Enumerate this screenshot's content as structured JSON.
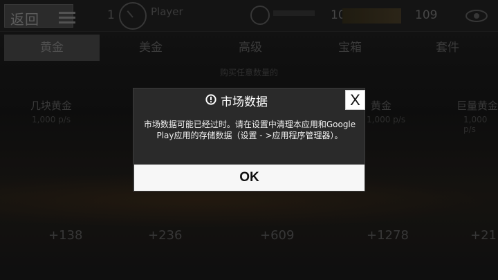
{
  "header": {
    "back_label": "返回",
    "level": "1",
    "player_name": "Player",
    "stat_1": "10",
    "stat_2": "109"
  },
  "tabs": [
    {
      "label": "黄金",
      "active": true
    },
    {
      "label": "美金",
      "active": false
    },
    {
      "label": "高级",
      "active": false
    },
    {
      "label": "宝箱",
      "active": false
    },
    {
      "label": "套件",
      "active": false
    }
  ],
  "store": {
    "note_line_1": "购买任意数量的",
    "items": [
      {
        "name": "几块黄金",
        "price": "1,000 p/s"
      },
      {
        "name": "黄金",
        "price": "1,000 p/s"
      },
      {
        "name": "巨量黄金",
        "price": "1,000 p/s"
      }
    ],
    "bonuses": [
      "+138",
      "+236",
      "+609",
      "+1278",
      "+21"
    ]
  },
  "dialog": {
    "title": "市场数据",
    "close_label": "X",
    "message": "市场数据可能已经过时。请在设置中清理本应用和Google Play应用的存储数据（设置 - >应用程序管理器）。",
    "ok_label": "OK"
  },
  "colors": {
    "dialog_bg": "#2a2a2a",
    "button_bg": "#f7f7f7",
    "text_light": "#ffffff"
  }
}
